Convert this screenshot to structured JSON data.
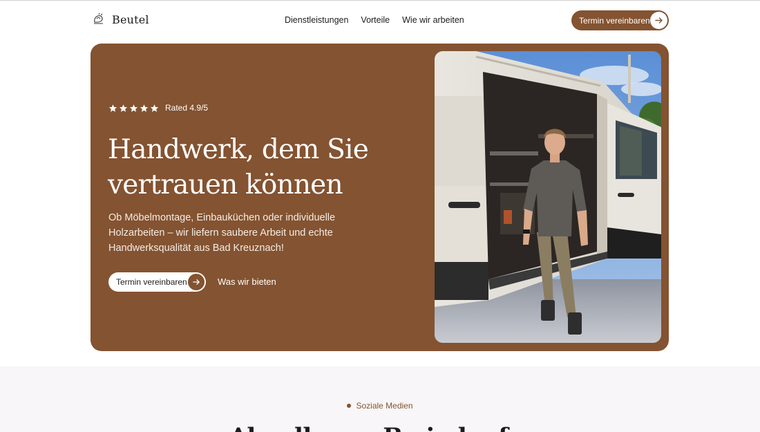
{
  "brand": {
    "name": "Beutel",
    "logo_icon": "hand-drawn-emblem-icon"
  },
  "nav": {
    "links": [
      "Dienstleistungen",
      "Vorteile",
      "Wie wir arbeiten"
    ],
    "cta_label": "Termin vereinbaren"
  },
  "hero": {
    "rating": {
      "stars": 5,
      "text": "Rated 4.9/5"
    },
    "headline_line1": "Handwerk, dem Sie",
    "headline_line2": "vertrauen können",
    "subline": "Ob Möbelmontage, Einbauküchen oder individuelle Holzarbeiten – wir liefern saubere Arbeit und echte Handwerksqualität aus Bad Kreuznach!",
    "cta_label": "Termin vereinbaren",
    "secondary_link": "Was wir bieten"
  },
  "section2": {
    "kicker": "Soziale Medien",
    "title": "Ab...dl...m...B...i...h...f..."
  },
  "colors": {
    "accent": "#845331",
    "background": "#ffffff",
    "section_background": "#f8f6f8",
    "text": "#1c1c1c"
  }
}
